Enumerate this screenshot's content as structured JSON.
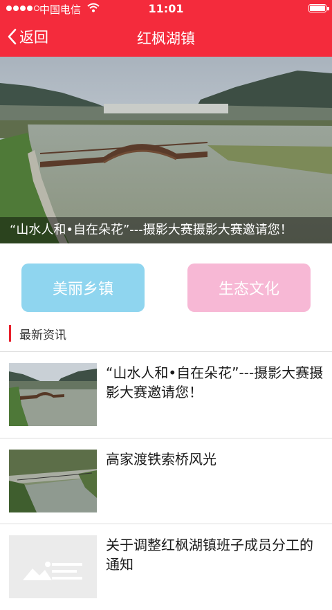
{
  "status_bar": {
    "carrier": "中国电信",
    "time": "11:01"
  },
  "nav": {
    "back_label": "返回",
    "title": "红枫湖镇"
  },
  "banner": {
    "caption": "“山水人和•自在朵花”---摄影大赛摄影大赛邀请您！"
  },
  "categories": [
    {
      "label": "美丽乡镇",
      "color": "#8fd5ef"
    },
    {
      "label": "生态文化",
      "color": "#f7b8d5"
    }
  ],
  "section": {
    "title": "最新资讯"
  },
  "news": [
    {
      "title": "“山水人和•自在朵花”---摄影大赛摄影大赛邀请您！"
    },
    {
      "title": "高家渡铁索桥风光"
    },
    {
      "title": "关于调整红枫湖镇班子成员分工的通知"
    }
  ],
  "colors": {
    "nav_bg": "#f42b3c",
    "accent": "#e8202c"
  }
}
